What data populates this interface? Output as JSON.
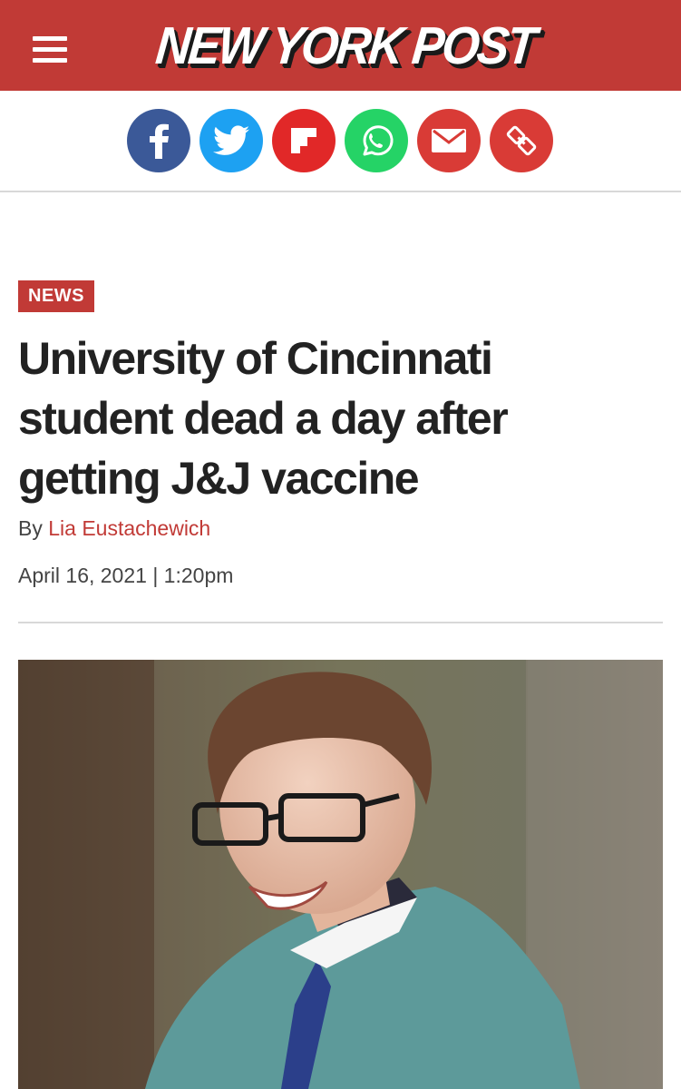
{
  "header": {
    "logo_text": "NEW YORK POST",
    "brand_color": "#c13a36"
  },
  "share_buttons": [
    {
      "icon": "facebook-icon",
      "color": "#3b5998"
    },
    {
      "icon": "twitter-icon",
      "color": "#1da1f2"
    },
    {
      "icon": "flipboard-icon",
      "color": "#e12828"
    },
    {
      "icon": "whatsapp-icon",
      "color": "#25d366"
    },
    {
      "icon": "email-icon",
      "color": "#d93b36"
    },
    {
      "icon": "link-icon",
      "color": "#d93b36"
    }
  ],
  "article": {
    "section_tag": "NEWS",
    "headline_line1": "University of Cincinnati",
    "headline_line2": "student dead a day after",
    "headline_line3": "getting J&J vaccine",
    "byline_prefix": "By ",
    "author": "Lia Eustachewich",
    "dateline": "April 16, 2021 | 1:20pm"
  }
}
